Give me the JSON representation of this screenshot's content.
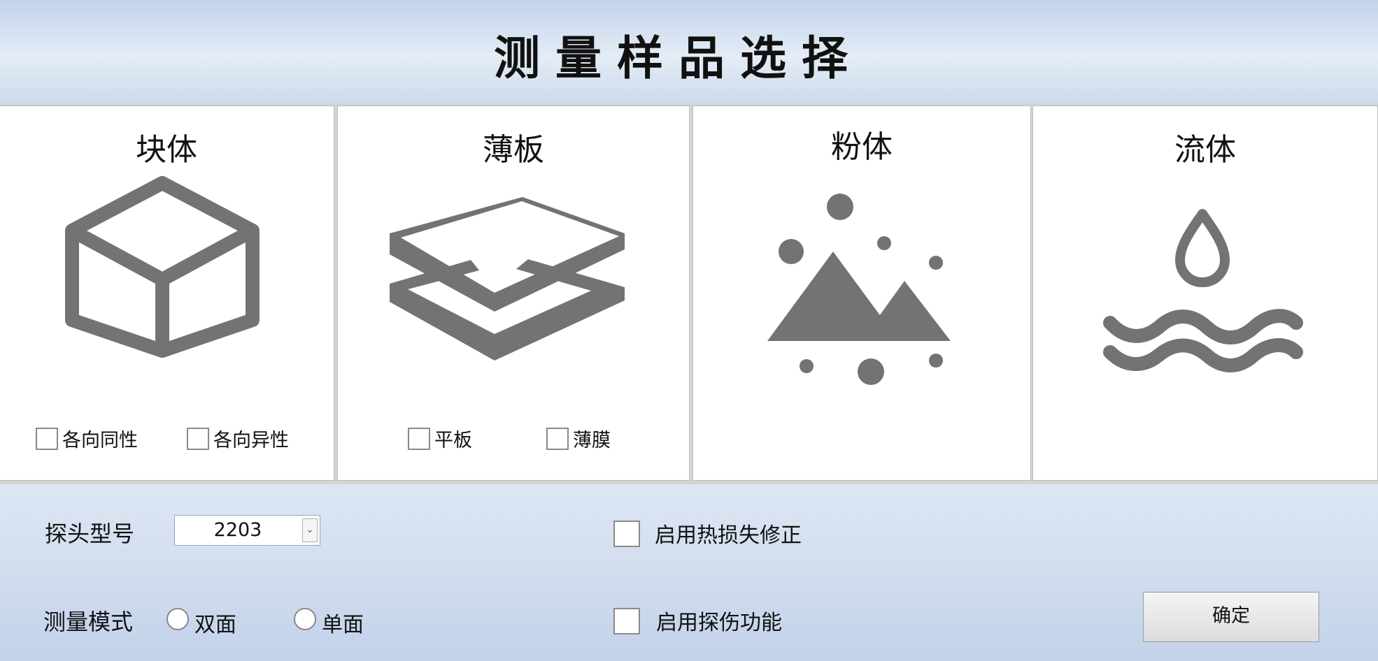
{
  "header": {
    "title": "测量样品选择"
  },
  "panels": {
    "bulk": {
      "title": "块体",
      "icon": "cube-icon",
      "options": [
        {
          "label": "各向同性",
          "checked": false
        },
        {
          "label": "各向异性",
          "checked": false
        }
      ]
    },
    "sheet": {
      "title": "薄板",
      "icon": "layered-plates-icon",
      "options": [
        {
          "label": "平板",
          "checked": false
        },
        {
          "label": "薄膜",
          "checked": false
        }
      ]
    },
    "powder": {
      "title": "粉体",
      "icon": "powder-mountain-icon"
    },
    "fluid": {
      "title": "流体",
      "icon": "water-drop-waves-icon"
    }
  },
  "settings": {
    "probe_label": "探头型号",
    "probe_value": "2203",
    "mode_label": "测量模式",
    "mode_options": [
      {
        "label": "双面",
        "selected": false
      },
      {
        "label": "单面",
        "selected": false
      }
    ],
    "heat_loss_label": "启用热损失修正",
    "heat_loss_checked": false,
    "flaw_label": "启用探伤功能",
    "flaw_checked": false,
    "confirm_label": "确定"
  },
  "colors": {
    "icon": "#737373",
    "header_gradient": "#c3d3ea",
    "panel_bg": "#ffffff"
  }
}
